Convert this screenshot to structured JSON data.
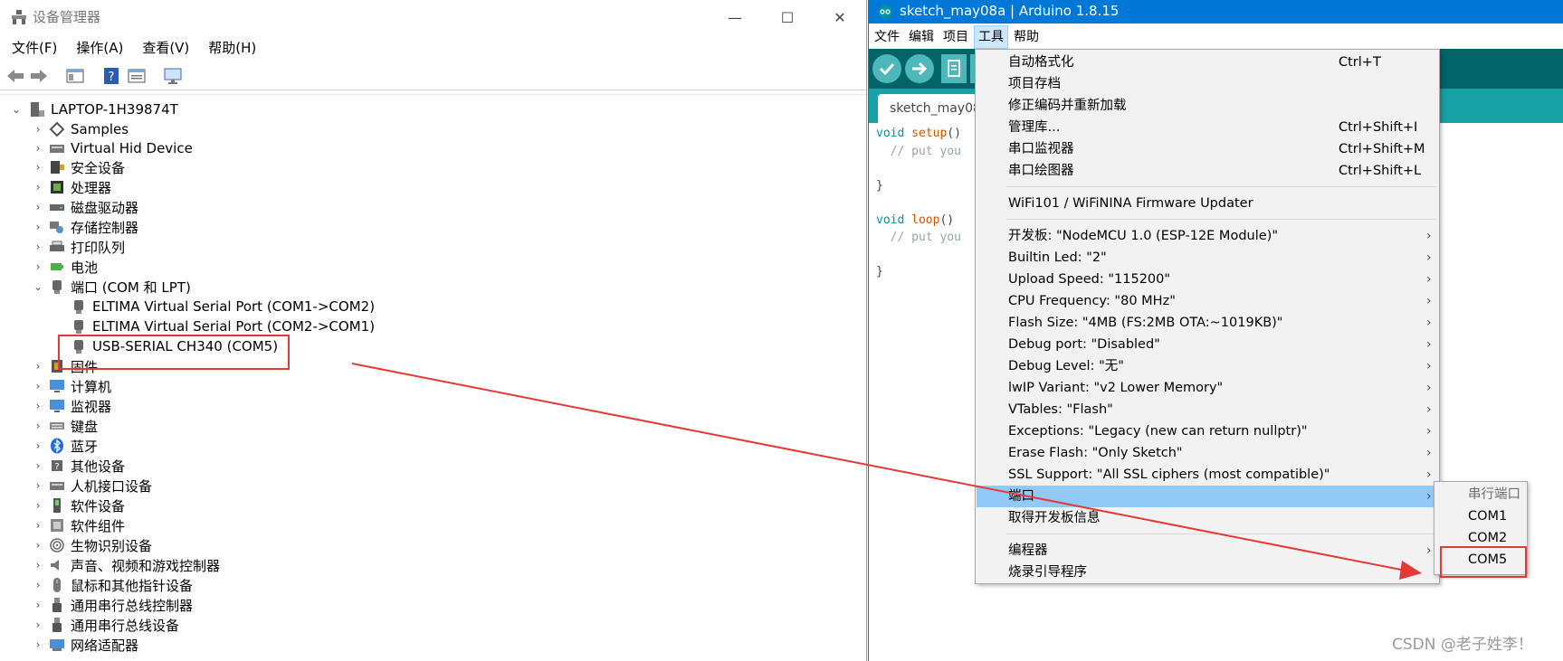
{
  "device_manager": {
    "title": "设备管理器",
    "window_buttons": {
      "minimize": "—",
      "maximize": "☐",
      "close": "✕"
    },
    "menus": [
      "文件(F)",
      "操作(A)",
      "查看(V)",
      "帮助(H)"
    ],
    "tree": {
      "root": "LAPTOP-1H39874T",
      "categories_before_ports": [
        "Samples",
        "Virtual Hid Device",
        "安全设备",
        "处理器",
        "磁盘驱动器",
        "存储控制器",
        "打印队列",
        "电池"
      ],
      "ports": {
        "label": "端口 (COM 和 LPT)",
        "children": [
          "ELTIMA Virtual Serial Port (COM1->COM2)",
          "ELTIMA Virtual Serial Port (COM2->COM1)",
          "USB-SERIAL CH340 (COM5)"
        ]
      },
      "categories_after_ports": [
        "固件",
        "计算机",
        "监视器",
        "键盘",
        "蓝牙",
        "其他设备",
        "人机接口设备",
        "软件设备",
        "软件组件",
        "生物识别设备",
        "声音、视频和游戏控制器",
        "鼠标和其他指针设备",
        "通用串行总线控制器",
        "通用串行总线设备",
        "网络适配器"
      ]
    }
  },
  "arduino": {
    "title": "sketch_may08a | Arduino 1.8.15",
    "menus": [
      "文件",
      "编辑",
      "项目",
      "工具",
      "帮助"
    ],
    "active_menu": "工具",
    "tab_label": "sketch_may08a",
    "code": {
      "line1_kw": "void",
      "line1_fn": "setup",
      "line1_rest": "()",
      "line2_comment": "// put you",
      "line3": "}",
      "line4_kw": "void",
      "line4_fn": "loop",
      "line4_rest": "()",
      "line5_comment": "// put you",
      "line6": "}"
    },
    "tools_menu": {
      "group1": [
        {
          "label": "自动格式化",
          "shortcut": "Ctrl+T"
        },
        {
          "label": "项目存档",
          "shortcut": ""
        },
        {
          "label": "修正编码并重新加载",
          "shortcut": ""
        },
        {
          "label": "管理库...",
          "shortcut": "Ctrl+Shift+I"
        },
        {
          "label": "串口监视器",
          "shortcut": "Ctrl+Shift+M"
        },
        {
          "label": "串口绘图器",
          "shortcut": "Ctrl+Shift+L"
        }
      ],
      "group2": [
        {
          "label": "WiFi101 / WiFiNINA Firmware Updater"
        }
      ],
      "group3": [
        {
          "label": "开发板: \"NodeMCU 1.0 (ESP-12E Module)\"",
          "submenu": true
        },
        {
          "label": "Builtin Led: \"2\"",
          "submenu": true
        },
        {
          "label": "Upload Speed: \"115200\"",
          "submenu": true
        },
        {
          "label": "CPU Frequency: \"80 MHz\"",
          "submenu": true
        },
        {
          "label": "Flash Size: \"4MB (FS:2MB OTA:~1019KB)\"",
          "submenu": true
        },
        {
          "label": "Debug port: \"Disabled\"",
          "submenu": true
        },
        {
          "label": "Debug Level: \"无\"",
          "submenu": true
        },
        {
          "label": "lwIP Variant: \"v2 Lower Memory\"",
          "submenu": true
        },
        {
          "label": "VTables: \"Flash\"",
          "submenu": true
        },
        {
          "label": "Exceptions: \"Legacy (new can return nullptr)\"",
          "submenu": true
        },
        {
          "label": "Erase Flash: \"Only Sketch\"",
          "submenu": true
        },
        {
          "label": "SSL Support: \"All SSL ciphers (most compatible)\"",
          "submenu": true
        },
        {
          "label": "端口",
          "submenu": true,
          "highlighted": true
        },
        {
          "label": "取得开发板信息",
          "submenu": false
        }
      ],
      "group4": [
        {
          "label": "编程器",
          "submenu": true
        },
        {
          "label": "烧录引导程序",
          "submenu": false
        }
      ],
      "submenu_arrow": "›"
    },
    "port_submenu": {
      "header": "串行端口",
      "ports": [
        "COM1",
        "COM2",
        "COM5"
      ]
    }
  },
  "watermark": "CSDN @老子姓李！",
  "colors": {
    "arduino_titlebar": "#0078d7",
    "arduino_toolbar": "#006468",
    "arduino_tabstrip": "#17a1a5",
    "menu_highlight": "#91c9f7",
    "annotation_red": "#e53935"
  }
}
